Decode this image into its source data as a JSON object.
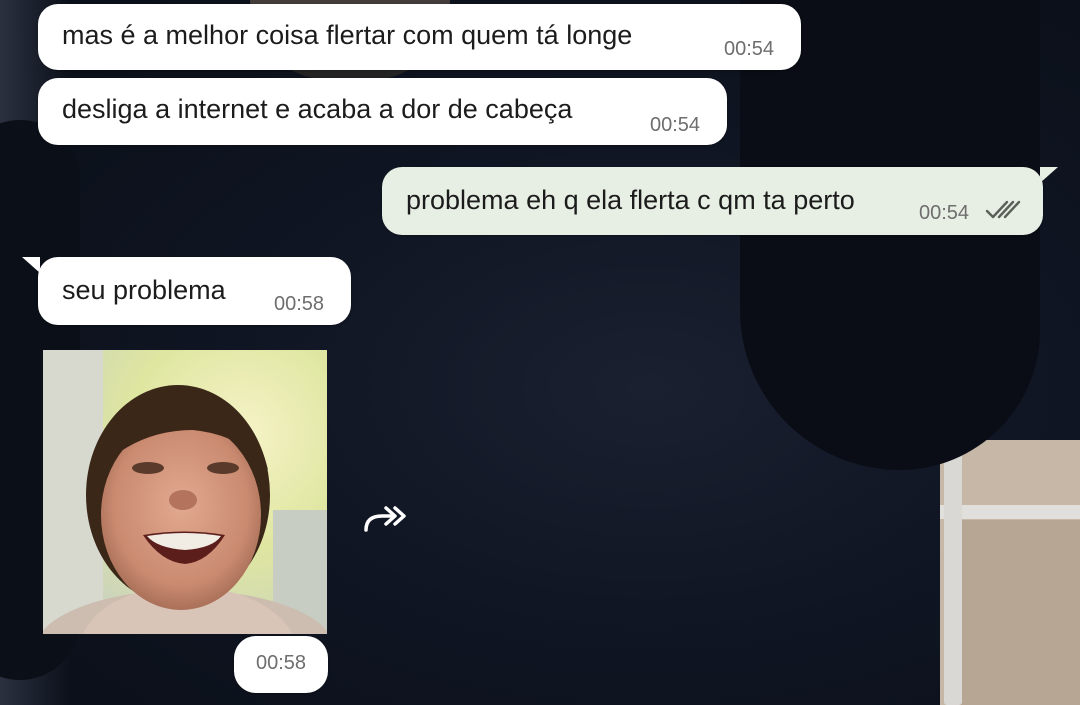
{
  "messages": [
    {
      "id": "m1",
      "direction": "incoming",
      "text": "mas é a melhor coisa flertar com quem tá longe",
      "time": "00:54"
    },
    {
      "id": "m2",
      "direction": "incoming",
      "text": "desliga a internet e acaba a dor de cabeça",
      "time": "00:54"
    },
    {
      "id": "m3",
      "direction": "outgoing",
      "text": "problema eh q ela flerta c qm ta perto",
      "time": "00:54",
      "status": "read-double-check-icon"
    },
    {
      "id": "m4",
      "direction": "incoming",
      "text": "seu problema",
      "time": "00:58"
    },
    {
      "id": "m5",
      "direction": "incoming",
      "type": "image",
      "time": "00:58",
      "icon": "forward-icon"
    }
  ],
  "colors": {
    "incoming_bubble": "#ffffff",
    "outgoing_bubble": "#e7eee3",
    "text": "#1c1c1c",
    "time": "#6e6e6e"
  }
}
